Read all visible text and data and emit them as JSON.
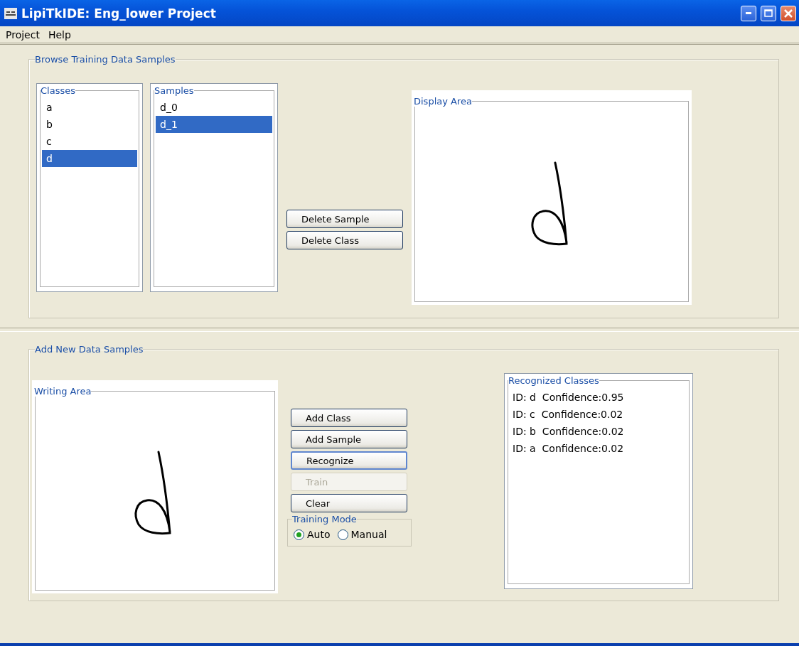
{
  "window": {
    "title": "LipiTkIDE: Eng_lower  Project"
  },
  "menu": [
    "Project",
    "Help"
  ],
  "browse": {
    "title": "Browse Training Data Samples",
    "classes": {
      "title": "Classes",
      "items": [
        {
          "label": "a",
          "selected": false
        },
        {
          "label": "b",
          "selected": false
        },
        {
          "label": "c",
          "selected": false
        },
        {
          "label": "d",
          "selected": true
        }
      ]
    },
    "samples": {
      "title": "Samples",
      "items": [
        {
          "label": "d_0",
          "selected": false
        },
        {
          "label": "d_1",
          "selected": true
        }
      ]
    },
    "buttons": [
      {
        "label": "Delete Sample",
        "disabled": false
      },
      {
        "label": "Delete Class",
        "disabled": false
      }
    ],
    "display": {
      "title": "Display Area"
    }
  },
  "add": {
    "title": "Add New Data Samples",
    "writing": {
      "title": "Writing Area"
    },
    "buttons": [
      {
        "label": "Add Class",
        "disabled": false,
        "focused": false
      },
      {
        "label": "Add Sample",
        "disabled": false,
        "focused": false
      },
      {
        "label": "Recognize",
        "disabled": false,
        "focused": true
      },
      {
        "label": "Train",
        "disabled": true,
        "focused": false
      },
      {
        "label": "Clear",
        "disabled": false,
        "focused": false
      }
    ],
    "training_mode": {
      "title": "Training Mode",
      "options": [
        {
          "label": "Auto",
          "selected": true
        },
        {
          "label": "Manual",
          "selected": false
        }
      ]
    },
    "recognized": {
      "title": "Recognized Classes",
      "rows": [
        "ID: d  Confidence:0.95",
        "ID: c  Confidence:0.02",
        "ID: b  Confidence:0.02",
        "ID: a  Confidence:0.02"
      ]
    }
  }
}
